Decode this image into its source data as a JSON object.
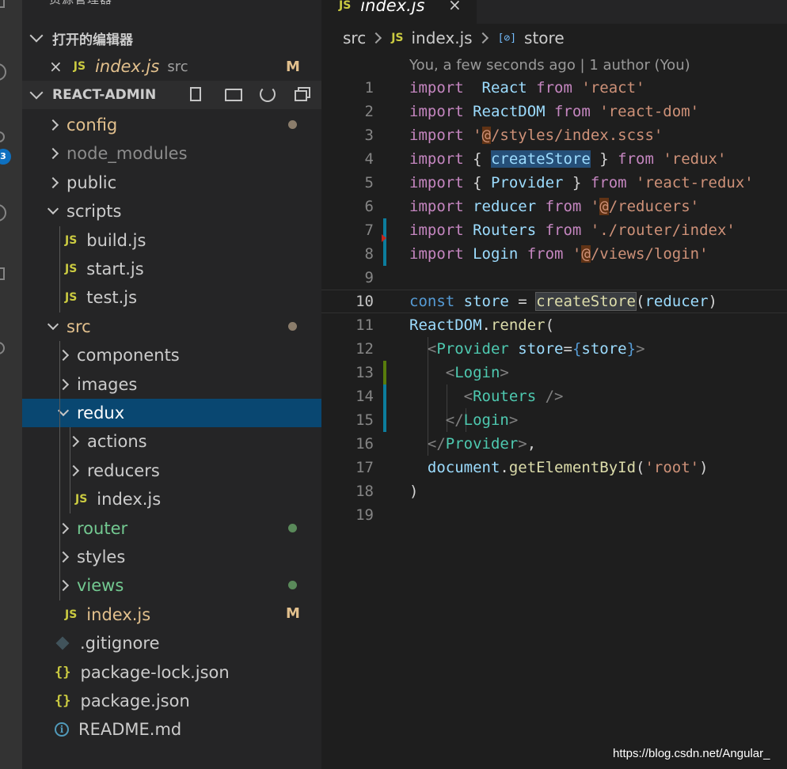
{
  "explorer": {
    "header": "资源管理器",
    "open_editors": {
      "title": "打开的编辑器",
      "items": [
        {
          "name": "index.js",
          "folder": "src",
          "badge": "M"
        }
      ]
    },
    "project": {
      "title": "REACT-ADMIN"
    },
    "tree": [
      {
        "label": "config",
        "type": "folder",
        "open": false,
        "indent": 0,
        "color": "#e2c08d",
        "dot": "#8b7d6b"
      },
      {
        "label": "node_modules",
        "type": "folder",
        "open": false,
        "indent": 0,
        "color": "#8c8c8c"
      },
      {
        "label": "public",
        "type": "folder",
        "open": false,
        "indent": 0,
        "color": "#cccccc"
      },
      {
        "label": "scripts",
        "type": "folder",
        "open": true,
        "indent": 0,
        "color": "#cccccc"
      },
      {
        "label": "build.js",
        "type": "js",
        "indent": 1,
        "color": "#cccccc"
      },
      {
        "label": "start.js",
        "type": "js",
        "indent": 1,
        "color": "#cccccc"
      },
      {
        "label": "test.js",
        "type": "js",
        "indent": 1,
        "color": "#cccccc"
      },
      {
        "label": "src",
        "type": "folder",
        "open": true,
        "indent": 0,
        "color": "#e2c08d",
        "dot": "#8b7d6b"
      },
      {
        "label": "components",
        "type": "folder",
        "open": false,
        "indent": 1,
        "color": "#cccccc"
      },
      {
        "label": "images",
        "type": "folder",
        "open": false,
        "indent": 1,
        "color": "#cccccc"
      },
      {
        "label": "redux",
        "type": "folder",
        "open": true,
        "indent": 1,
        "color": "#ffffff",
        "selected": true
      },
      {
        "label": "actions",
        "type": "folder",
        "open": false,
        "indent": 2,
        "color": "#cccccc"
      },
      {
        "label": "reducers",
        "type": "folder",
        "open": false,
        "indent": 2,
        "color": "#cccccc"
      },
      {
        "label": "index.js",
        "type": "js",
        "indent": 2,
        "color": "#cccccc"
      },
      {
        "label": "router",
        "type": "folder",
        "open": false,
        "indent": 1,
        "color": "#73c991",
        "dot": "#5a8a5a"
      },
      {
        "label": "styles",
        "type": "folder",
        "open": false,
        "indent": 1,
        "color": "#cccccc"
      },
      {
        "label": "views",
        "type": "folder",
        "open": false,
        "indent": 1,
        "color": "#73c991",
        "dot": "#5a8a5a"
      },
      {
        "label": "index.js",
        "type": "js",
        "indent": 1,
        "color": "#e2c08d",
        "badge": "M"
      },
      {
        "label": ".gitignore",
        "type": "git",
        "indent": 0,
        "color": "#cccccc"
      },
      {
        "label": "package-lock.json",
        "type": "json",
        "indent": 0,
        "color": "#cccccc"
      },
      {
        "label": "package.json",
        "type": "json",
        "indent": 0,
        "color": "#cccccc"
      },
      {
        "label": "README.md",
        "type": "info",
        "indent": 0,
        "color": "#cccccc"
      }
    ]
  },
  "editor": {
    "tab": {
      "title": "index.js",
      "icon_text": "JS"
    },
    "breadcrumb": {
      "folder": "src",
      "file": "index.js",
      "symbol": "store",
      "js_icon": "JS",
      "symbol_icon": "[⊘]"
    },
    "blame": "You, a few seconds ago | 1 author (You)",
    "lines": [
      {
        "n": "1",
        "parts": [
          [
            "k1",
            "import"
          ],
          [
            "",
            "  "
          ],
          [
            "id",
            "React"
          ],
          [
            "",
            ""
          ],
          [
            "k1",
            " from "
          ],
          [
            "st",
            "'react'"
          ]
        ]
      },
      {
        "n": "2",
        "parts": [
          [
            "k1",
            "import "
          ],
          [
            "id",
            "ReactDOM"
          ],
          [
            "k1",
            " from "
          ],
          [
            "st",
            "'react-dom'"
          ]
        ]
      },
      {
        "n": "3",
        "parts": [
          [
            "k1",
            "import "
          ],
          [
            "st",
            "'"
          ],
          [
            "st at-hl",
            "@"
          ],
          [
            "st",
            "/styles/index.scss'"
          ]
        ]
      },
      {
        "n": "4",
        "parts": [
          [
            "k1",
            "import "
          ],
          [
            "",
            "{ "
          ],
          [
            "id hl",
            "createStore"
          ],
          [
            "",
            " } "
          ],
          [
            "k1",
            "from "
          ],
          [
            "st",
            "'redux'"
          ]
        ]
      },
      {
        "n": "5",
        "parts": [
          [
            "k1",
            "import "
          ],
          [
            "",
            "{ "
          ],
          [
            "id",
            "Provider"
          ],
          [
            "",
            " } "
          ],
          [
            "k1",
            "from "
          ],
          [
            "st",
            "'react-redux'"
          ]
        ]
      },
      {
        "n": "6",
        "parts": [
          [
            "k1",
            "import "
          ],
          [
            "id",
            "reducer"
          ],
          [
            "k1",
            " from "
          ],
          [
            "st",
            "'"
          ],
          [
            "st at-hl",
            "@"
          ],
          [
            "st",
            "/reducers'"
          ]
        ]
      },
      {
        "n": "7",
        "parts": [
          [
            "k1",
            "import "
          ],
          [
            "id",
            "Routers"
          ],
          [
            "k1",
            " from "
          ],
          [
            "st",
            "'./router/index'"
          ]
        ]
      },
      {
        "n": "8",
        "parts": [
          [
            "k1",
            "import "
          ],
          [
            "id",
            "Login"
          ],
          [
            "k1",
            " from "
          ],
          [
            "st",
            "'"
          ],
          [
            "st at-hl",
            "@"
          ],
          [
            "st",
            "/views/login'"
          ]
        ]
      },
      {
        "n": "9",
        "parts": []
      },
      {
        "n": "10",
        "parts": [
          [
            "k2",
            "const "
          ],
          [
            "id",
            "store"
          ],
          [
            "",
            " = "
          ],
          [
            "fn hl2",
            "createStore"
          ],
          [
            "",
            "("
          ],
          [
            "id",
            "reducer"
          ],
          [
            "",
            ")"
          ]
        ]
      },
      {
        "n": "11",
        "parts": [
          [
            "id",
            "ReactDOM"
          ],
          [
            "",
            "."
          ],
          [
            "fn",
            "render"
          ],
          [
            "",
            "("
          ]
        ]
      },
      {
        "n": "12",
        "parts": [
          [
            "",
            "  "
          ],
          [
            "pu",
            "<"
          ],
          [
            "tg",
            "Provider"
          ],
          [
            "at",
            " store"
          ],
          [
            "",
            "="
          ],
          [
            "k2",
            "{"
          ],
          [
            "id",
            "store"
          ],
          [
            "k2",
            "}"
          ],
          [
            "pu",
            ">"
          ]
        ]
      },
      {
        "n": "13",
        "parts": [
          [
            "",
            "    "
          ],
          [
            "pu",
            "<"
          ],
          [
            "tg",
            "Login"
          ],
          [
            "pu",
            ">"
          ]
        ]
      },
      {
        "n": "14",
        "parts": [
          [
            "",
            "      "
          ],
          [
            "pu",
            "<"
          ],
          [
            "tg",
            "Routers"
          ],
          [
            "pu",
            " />"
          ]
        ]
      },
      {
        "n": "15",
        "parts": [
          [
            "",
            "    "
          ],
          [
            "pu",
            "</"
          ],
          [
            "tg",
            "Login"
          ],
          [
            "pu",
            ">"
          ]
        ]
      },
      {
        "n": "16",
        "parts": [
          [
            "",
            "  "
          ],
          [
            "pu",
            "</"
          ],
          [
            "tg",
            "Provider"
          ],
          [
            "pu",
            ">"
          ],
          [
            "",
            ","
          ]
        ]
      },
      {
        "n": "17",
        "parts": [
          [
            "",
            "  "
          ],
          [
            "id",
            "document"
          ],
          [
            "",
            "."
          ],
          [
            "fn",
            "getElementById"
          ],
          [
            "",
            "("
          ],
          [
            "st",
            "'root'"
          ],
          [
            "",
            ")"
          ]
        ]
      },
      {
        "n": "18",
        "parts": [
          [
            "",
            ")"
          ]
        ]
      },
      {
        "n": "19",
        "parts": []
      }
    ]
  },
  "watermark": "https://blog.csdn.net/Angular_",
  "colors": {
    "accent": "#094771",
    "badge": "#0e70c0",
    "modified": "#e2c08d",
    "untracked": "#73c991"
  }
}
